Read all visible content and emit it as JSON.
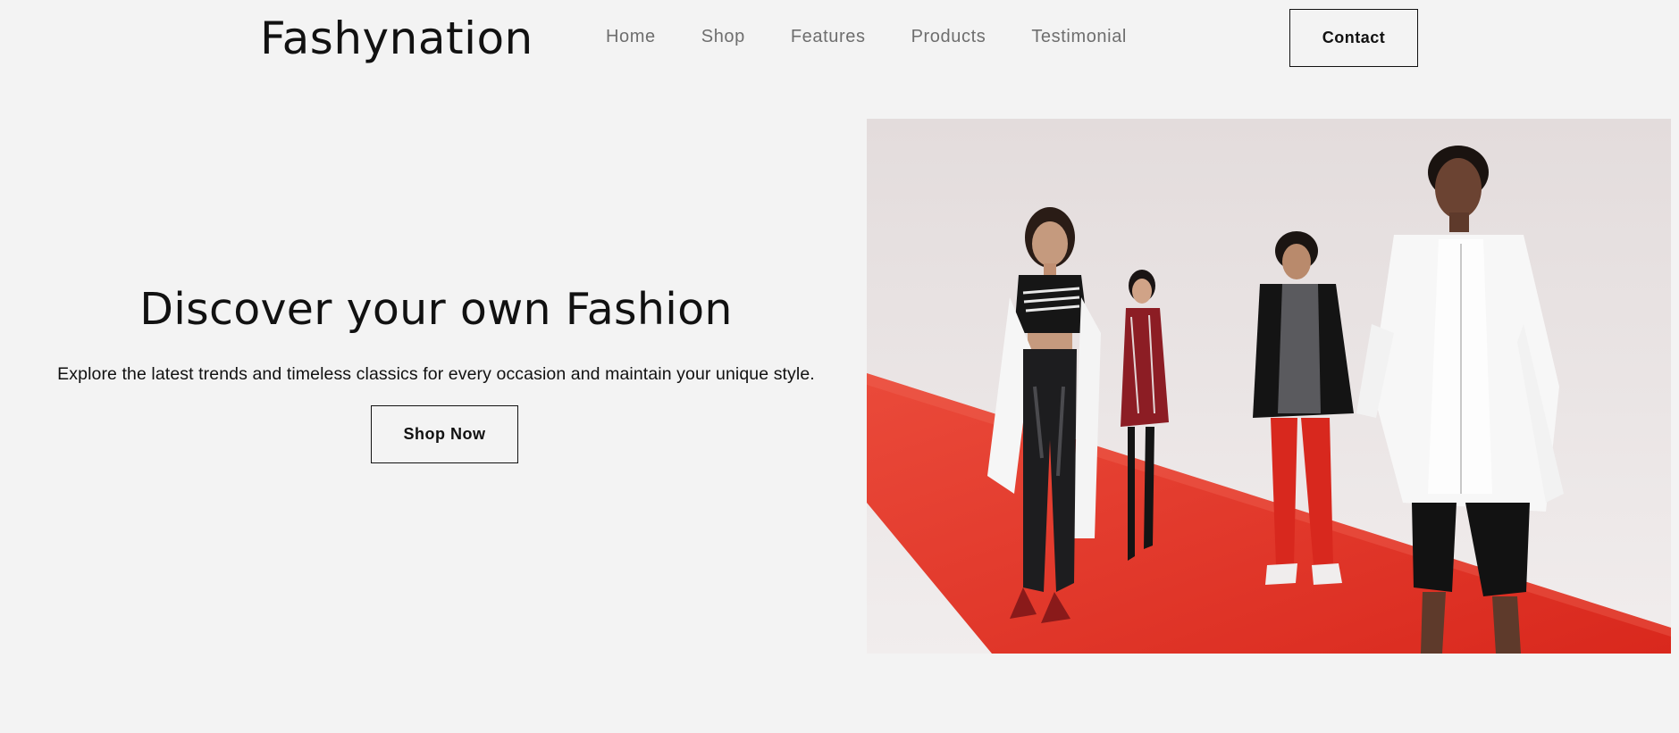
{
  "header": {
    "logo": "Fashynation",
    "nav": [
      "Home",
      "Shop",
      "Features",
      "Products",
      "Testimonial"
    ],
    "contact_label": "Contact"
  },
  "hero": {
    "title": "Discover your own Fashion",
    "subtitle": "Explore the latest trends and timeless classics for every occasion and maintain your unique style.",
    "cta_label": "Shop Now"
  },
  "colors": {
    "background": "#f3f3f3",
    "text": "#111111",
    "nav_text": "#6e6e6e",
    "runway_red": "#e33a2c"
  }
}
